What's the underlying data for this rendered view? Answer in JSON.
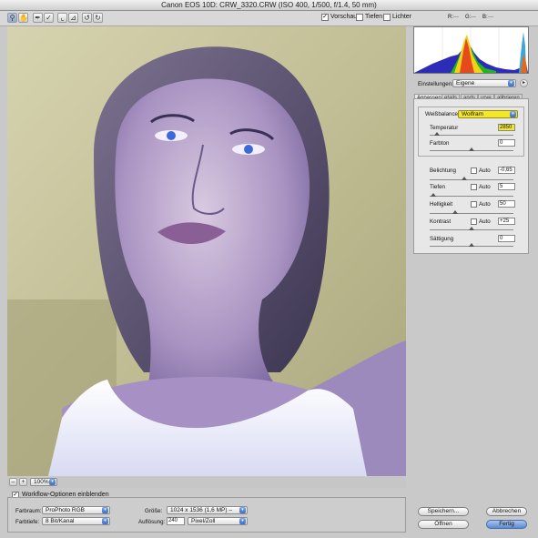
{
  "window": {
    "title": "Canon EOS 10D:  CRW_3320.CRW  (ISO 400, 1/500, f/1.4, 50 mm)"
  },
  "toolbar": {
    "tools": [
      "zoom-icon",
      "hand-icon",
      "eyedropper-icon",
      "color-sampler-icon",
      "crop-icon",
      "straighten-icon",
      "rotate-left-icon",
      "rotate-right-icon"
    ],
    "preview_label": "Vorschau",
    "preview_checked": true,
    "shadows_label": "Tiefen",
    "highlights_label": "Lichter",
    "readout_r": "R:",
    "readout_g": "G:",
    "readout_b": "B:",
    "readout_dash": "---"
  },
  "zoom": {
    "minus": "–",
    "plus": "+",
    "value": "100%"
  },
  "settings": {
    "label": "Einstellungen:",
    "value": "Eigene"
  },
  "tabs": [
    "Anpassen",
    "Details",
    "Objektiv",
    "Kurve",
    "Kalibrieren"
  ],
  "tabs_display": [
    "Anpassen",
    "etails",
    "ands",
    "urve",
    "alibrieren"
  ],
  "adjust": {
    "wb_label": "Weißbalance:",
    "wb_value": "Wolfram",
    "temperature_label": "Temperatur",
    "temperature_value": "2850",
    "tint_label": "Farbton",
    "tint_value": "0",
    "exposure_label": "Belichtung",
    "exposure_value": "-0,65",
    "shadows_label": "Tiefen",
    "shadows_value": "5",
    "brightness_label": "Helligkeit",
    "brightness_value": "50",
    "contrast_label": "Kontrast",
    "contrast_value": "+25",
    "saturation_label": "Sättigung",
    "saturation_value": "0",
    "auto_label": "Auto"
  },
  "workflow": {
    "show_label": "Workflow-Optionen einblenden",
    "show_checked": true,
    "space_label": "Farbraum:",
    "space_value": "ProPhoto RGB",
    "depth_label": "Farbtiefe:",
    "depth_value": "8 Bit/Kanal",
    "size_label": "Größe:",
    "size_value": "1024 x 1536 (1,6 MP)  –",
    "resolution_label": "Auflösung:",
    "resolution_value": "240",
    "resolution_unit": "Pixel/Zoll"
  },
  "buttons": {
    "save": "Speichern...",
    "open": "Öffnen",
    "cancel": "Abbrechen",
    "done": "Fertig"
  },
  "colors": {
    "accent": "#5b8ad2",
    "highlight_field": "#f3e72a",
    "photo_bg": "#c8c49b"
  }
}
